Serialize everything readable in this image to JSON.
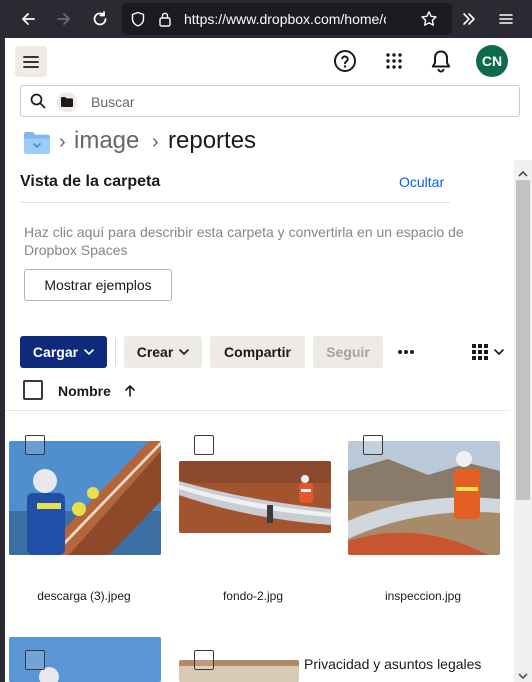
{
  "browser": {
    "url_main": "https://www.dropbox.com/home/cali",
    "url_dim": "d"
  },
  "topbar": {
    "avatar_initials": "CN"
  },
  "search": {
    "placeholder": "Buscar"
  },
  "breadcrumb": {
    "items": [
      "image",
      "reportes"
    ]
  },
  "folder_panel": {
    "title": "Vista de la carpeta",
    "hide_label": "Ocultar",
    "description": "Haz clic aquí para describir esta carpeta y convertirla en un espacio de Dropbox Spaces",
    "examples_button": "Mostrar ejemplos"
  },
  "toolbar": {
    "upload": "Cargar",
    "create": "Crear",
    "share": "Compartir",
    "follow": "Seguir"
  },
  "list_header": {
    "name_column": "Nombre"
  },
  "files": [
    {
      "name": "descarga (3).jpeg"
    },
    {
      "name": "fondo-2.jpg"
    },
    {
      "name": "inspeccion.jpg"
    }
  ],
  "footer": {
    "privacy_link": "Privacidad y asuntos legales"
  },
  "colors": {
    "upload_button": "#0e2a7a",
    "link": "#0061fe",
    "avatar": "#0d6b4b"
  }
}
